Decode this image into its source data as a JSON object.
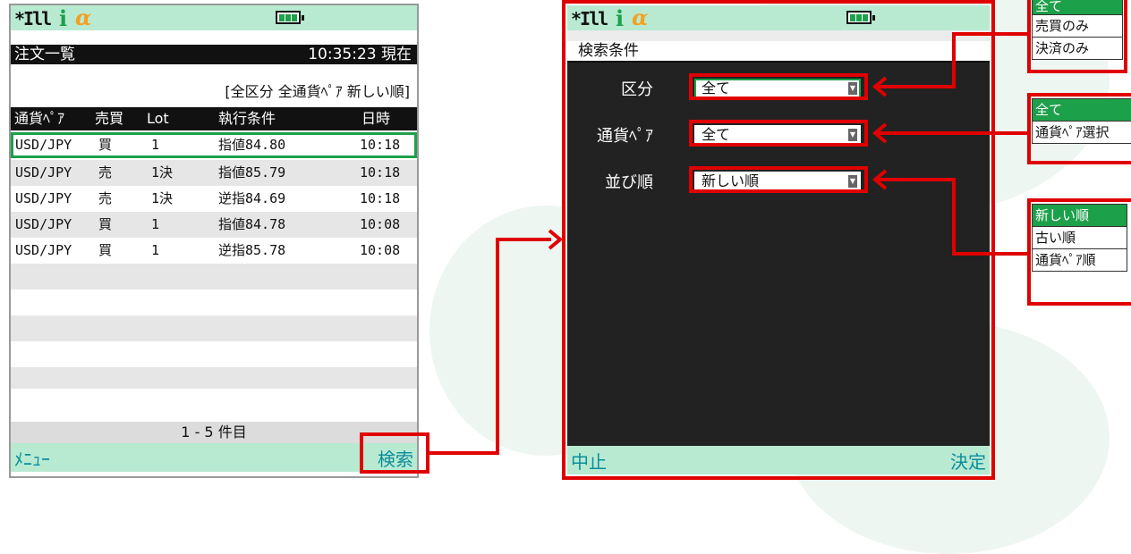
{
  "left_screen": {
    "title": "注文一覧",
    "time": "10:35:23 現在",
    "filter_summary": "[全区分 全通貨ﾍﾟｱ 新しい順]",
    "columns": [
      "通貨ﾍﾟｱ",
      "売買",
      "Lot",
      "執行条件",
      "日時"
    ],
    "rows": [
      {
        "pair": "USD/JPY",
        "side": "買",
        "lot": "1",
        "cond": "指値84.80",
        "time": "10:18"
      },
      {
        "pair": "USD/JPY",
        "side": "売",
        "lot": "1決",
        "cond": "指値85.79",
        "time": "10:18"
      },
      {
        "pair": "USD/JPY",
        "side": "売",
        "lot": "1決",
        "cond": "逆指84.69",
        "time": "10:18"
      },
      {
        "pair": "USD/JPY",
        "side": "買",
        "lot": "1",
        "cond": "指値84.78",
        "time": "10:08"
      },
      {
        "pair": "USD/JPY",
        "side": "買",
        "lot": "1",
        "cond": "逆指85.78",
        "time": "10:08"
      }
    ],
    "count": "1 - 5 件目",
    "softkey_left": "ﾒﾆｭｰ",
    "softkey_right": "検索"
  },
  "right_screen": {
    "title": "検索条件",
    "fields": [
      {
        "label": "区分",
        "value": "全て"
      },
      {
        "label": "通貨ﾍﾟｱ",
        "value": "全て"
      },
      {
        "label": "並び順",
        "value": "新しい順"
      }
    ],
    "softkey_left": "中止",
    "softkey_right": "決定"
  },
  "popups": {
    "category": [
      "全て",
      "売買のみ",
      "決済のみ"
    ],
    "pair": [
      "全て",
      "通貨ﾍﾟｱ選択"
    ],
    "order": [
      "新しい順",
      "古い順",
      "通貨ﾍﾟｱ順"
    ]
  },
  "status": {
    "i_mode": "i",
    "battery_icon": "battery-full-icon",
    "signal_icon": "signal-antenna-icon"
  },
  "colors": {
    "accent_green": "#1da04a",
    "status_bar": "#b8ead2",
    "highlight_red": "#e00000",
    "softkey_text": "#0a8d9a"
  }
}
